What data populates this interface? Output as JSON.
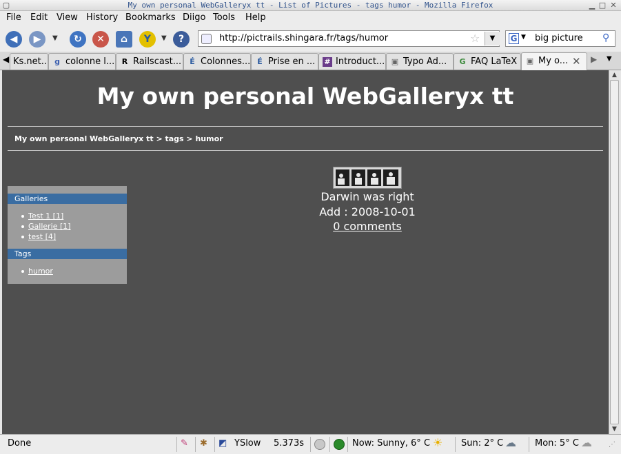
{
  "window": {
    "title": "My own personal WebGalleryx tt - List of Pictures - tags humor - Mozilla Firefox"
  },
  "menu": [
    "File",
    "Edit",
    "View",
    "History",
    "Bookmarks",
    "Diigo",
    "Tools",
    "Help"
  ],
  "url": "http://pictrails.shingara.fr/tags/humor",
  "search": {
    "value": "big picture",
    "engine_icon": "G"
  },
  "tabs": [
    {
      "label": "Ks.net...",
      "icon": ""
    },
    {
      "label": "colonne l...",
      "icon": "g"
    },
    {
      "label": "Railscast...",
      "icon": "R"
    },
    {
      "label": "Colonnes...",
      "icon": "É"
    },
    {
      "label": "Prise en ...",
      "icon": "É"
    },
    {
      "label": "Introduct...",
      "icon": "#"
    },
    {
      "label": "Typo Ad...",
      "icon": "▣"
    },
    {
      "label": "FAQ LaTeX",
      "icon": "G"
    },
    {
      "label": "My o...",
      "icon": "▣"
    }
  ],
  "page": {
    "title": "My own personal WebGalleryx tt",
    "breadcrumb": "My own personal WebGalleryx tt > tags > humor",
    "sidebar": {
      "galleries_heading": "Galleries",
      "galleries": [
        "Test 1 [1]",
        "Gallerie [1]",
        "test [4]"
      ],
      "tags_heading": "Tags",
      "tags": [
        "humor"
      ]
    },
    "picture": {
      "title": "Darwin was right",
      "added": "Add : 2008-10-01",
      "comments": "0 comments"
    }
  },
  "status": {
    "text": "Done",
    "yslow_label": "YSlow",
    "yslow_time": "5.373s",
    "weather_now": "Now: Sunny, 6° C",
    "weather_sun": "Sun: 2° C",
    "weather_mon": "Mon: 5° C"
  },
  "colors": {
    "page_bg": "#4f4f4f",
    "sidebar_header": "#3a6da2",
    "sidebar_bg": "#9c9c9c"
  }
}
